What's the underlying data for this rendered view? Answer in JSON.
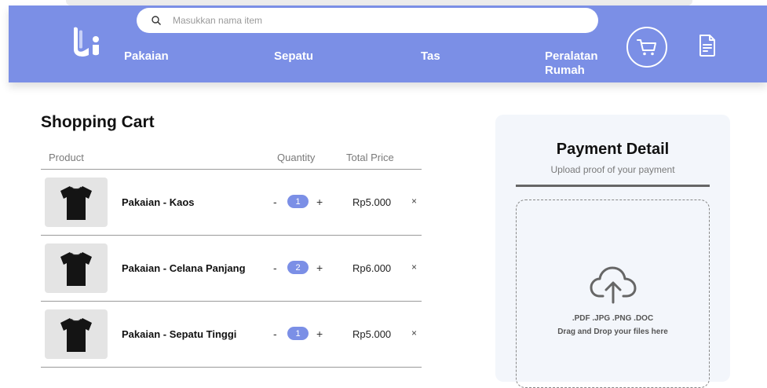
{
  "search": {
    "placeholder": "Masukkan nama item"
  },
  "nav": {
    "items": [
      {
        "label": "Pakaian"
      },
      {
        "label": "Sepatu"
      },
      {
        "label": "Tas"
      },
      {
        "label": "Peralatan Rumah"
      }
    ]
  },
  "icons": {
    "logo": "brand-logo-li",
    "cart": "cart-icon",
    "orders": "document-icon",
    "search": "search-icon",
    "upload": "cloud-upload-icon"
  },
  "colors": {
    "accent": "#7b8fe6",
    "panel": "#f3f6fb"
  },
  "cart": {
    "title": "Shopping Cart",
    "columns": {
      "product": "Product",
      "quantity": "Quantity",
      "total": "Total Price"
    },
    "rows": [
      {
        "name": "Pakaian - Kaos",
        "qty_minus": "-",
        "qty": "1",
        "qty_plus": "+",
        "price": "Rp5.000",
        "remove": "×"
      },
      {
        "name": "Pakaian - Celana Panjang",
        "qty_minus": "-",
        "qty": "2",
        "qty_plus": "+",
        "price": "Rp6.000",
        "remove": "×"
      },
      {
        "name": "Pakaian - Sepatu Tinggi",
        "qty_minus": "-",
        "qty": "1",
        "qty_plus": "+",
        "price": "Rp5.000",
        "remove": "×"
      }
    ]
  },
  "payment": {
    "title": "Payment Detail",
    "subtitle": "Upload proof of your payment",
    "formats": ".PDF .JPG .PNG .DOC",
    "drag_text": "Drag and Drop your files here"
  }
}
